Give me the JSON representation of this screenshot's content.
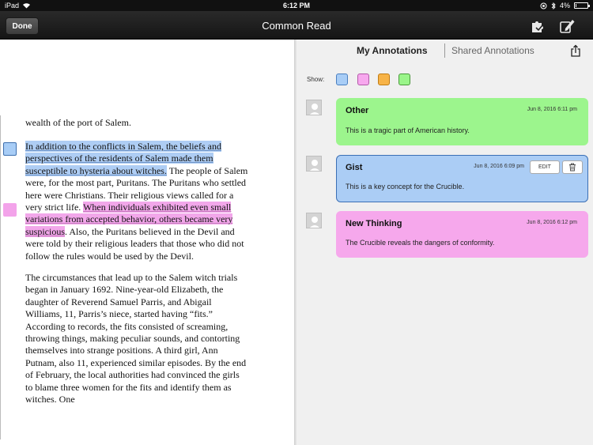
{
  "status_bar": {
    "device": "iPad",
    "time": "6:12 PM",
    "battery": "4%",
    "battery_level": 0.04
  },
  "nav": {
    "done_label": "Done",
    "title": "Common Read"
  },
  "reader": {
    "para1_line": "wealth of the port of Salem.",
    "para2": {
      "hl_blue_lines": [
        "In addition to the conflicts in Salem, the beliefs and",
        "perspectives of the residents of Salem made them",
        "susceptible to hysteria about witches."
      ],
      "after_blue": " The people of Salem",
      "lines_mid": [
        "were, for the most part, Puritans. The Puritans who settled",
        "here were Christians. Their religious views called for a"
      ],
      "before_pink": "very strict life. ",
      "hl_pink_lines": [
        "When individuals exhibited even small",
        "variations from accepted behavior, others became very",
        "suspicious"
      ],
      "after_pink": ". Also, the Puritans believed in the Devil and",
      "lines_end": [
        "were told by their religious leaders that those who did not",
        "follow the rules would be used by the Devil."
      ]
    },
    "para3_lines": [
      "The circumstances that lead up to the Salem witch trials",
      "began in January 1692. Nine-year-old Elizabeth, the",
      "daughter of Reverend Samuel Parris, and Abigail",
      "Williams, 11, Parris’s niece, started having “fits.”",
      "According to records, the fits consisted of screaming,",
      "throwing things, making peculiar sounds, and contorting",
      "themselves into strange positions. A third girl, Ann",
      "Putnam, also 11, experienced similar episodes. By the end",
      "of February, the local authorities had convinced the girls",
      "to blame three women for the fits and identify them as",
      "witches. One"
    ]
  },
  "annotations_panel": {
    "tab_mine": "My Annotations",
    "tab_shared": "Shared Annotations",
    "show_label": "Show:",
    "filters": [
      {
        "name": "blue",
        "color": "#a8cdf6",
        "border": "#4a7fc0"
      },
      {
        "name": "pink",
        "color": "#f7a8ee",
        "border": "#b25aa8"
      },
      {
        "name": "orange",
        "color": "#f7b347",
        "border": "#c07c14"
      },
      {
        "name": "green",
        "color": "#9af58a",
        "border": "#4a9a3c"
      }
    ],
    "edit_label": "EDIT",
    "cards": [
      {
        "type": "Other",
        "date": "Jun 8, 2016 6:11 pm",
        "text": "This is a tragic part of American history.",
        "bg": "#9cf58d",
        "border": "#9cf58d"
      },
      {
        "type": "Gist",
        "date": "Jun 8, 2016 6:09 pm",
        "text": "This is a key concept for the Crucible.",
        "bg": "#abcdf5",
        "border": "#3b6fb5"
      },
      {
        "type": "New Thinking",
        "date": "Jun 8, 2016 6:12 pm",
        "text": "The Crucible reveals the dangers of conformity.",
        "bg": "#f6a8ec",
        "border": "#f6a8ec"
      }
    ]
  }
}
